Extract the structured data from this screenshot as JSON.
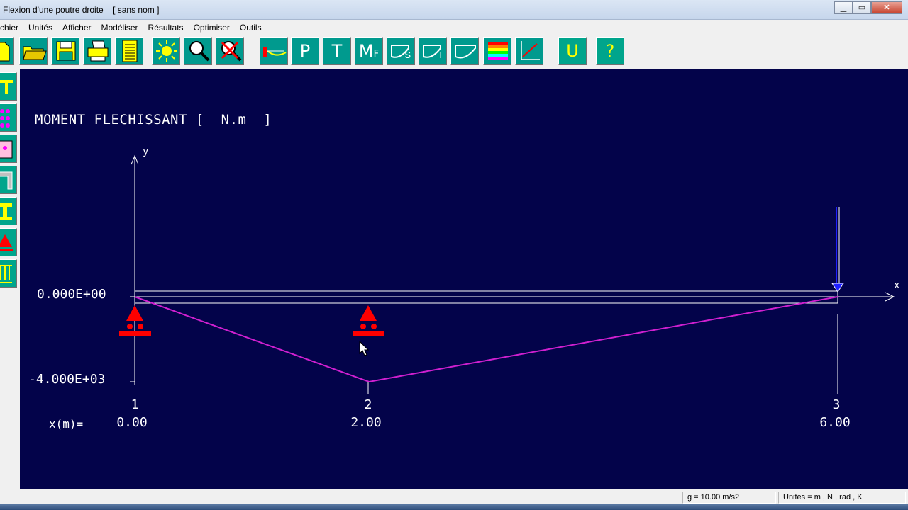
{
  "window": {
    "title": "Flexion d'une poutre droite",
    "document": "[ sans nom ]",
    "minimize_glyph": "▁",
    "maximize_glyph": "▭",
    "close_glyph": "✕"
  },
  "menu": {
    "items": [
      "chier",
      "Unités",
      "Afficher",
      "Modéliser",
      "Résultats",
      "Optimiser",
      "Outils"
    ]
  },
  "toolbar": {
    "letter_buttons": [
      "P",
      "T",
      "U",
      "?"
    ],
    "mf_label": "M",
    "mf_sub": "F",
    "s_sub": "S",
    "i_sub": "I"
  },
  "plot": {
    "title": "MOMENT FLECHISSANT [  N.m  ]",
    "y_axis_letter": "y",
    "x_axis_letter": "x",
    "y_tick_labels": [
      "0.000E+00",
      "-4.000E+03"
    ],
    "x_caption": "x(m)=",
    "nodes": [
      {
        "num": "1",
        "x_label": "0.00"
      },
      {
        "num": "2",
        "x_label": "2.00"
      },
      {
        "num": "3",
        "x_label": "6.00"
      }
    ]
  },
  "chart_data": {
    "type": "line",
    "title": "MOMENT FLECHISSANT [  N.m  ]",
    "xlabel": "x(m)",
    "ylabel": "y",
    "x": [
      0,
      2,
      6
    ],
    "series": [
      {
        "values": [
          0,
          -4000,
          0
        ]
      }
    ],
    "xlim": [
      0,
      6
    ],
    "ylim": [
      -4000,
      0
    ],
    "grid": false,
    "colors": {
      "curve": "#d020d0",
      "support": "#ff0000",
      "load": "#2020ff",
      "background": "#03034a"
    }
  },
  "status": {
    "gravity": "g = 10.00 m/s2",
    "units": "Unités = m , N , rad , K"
  }
}
